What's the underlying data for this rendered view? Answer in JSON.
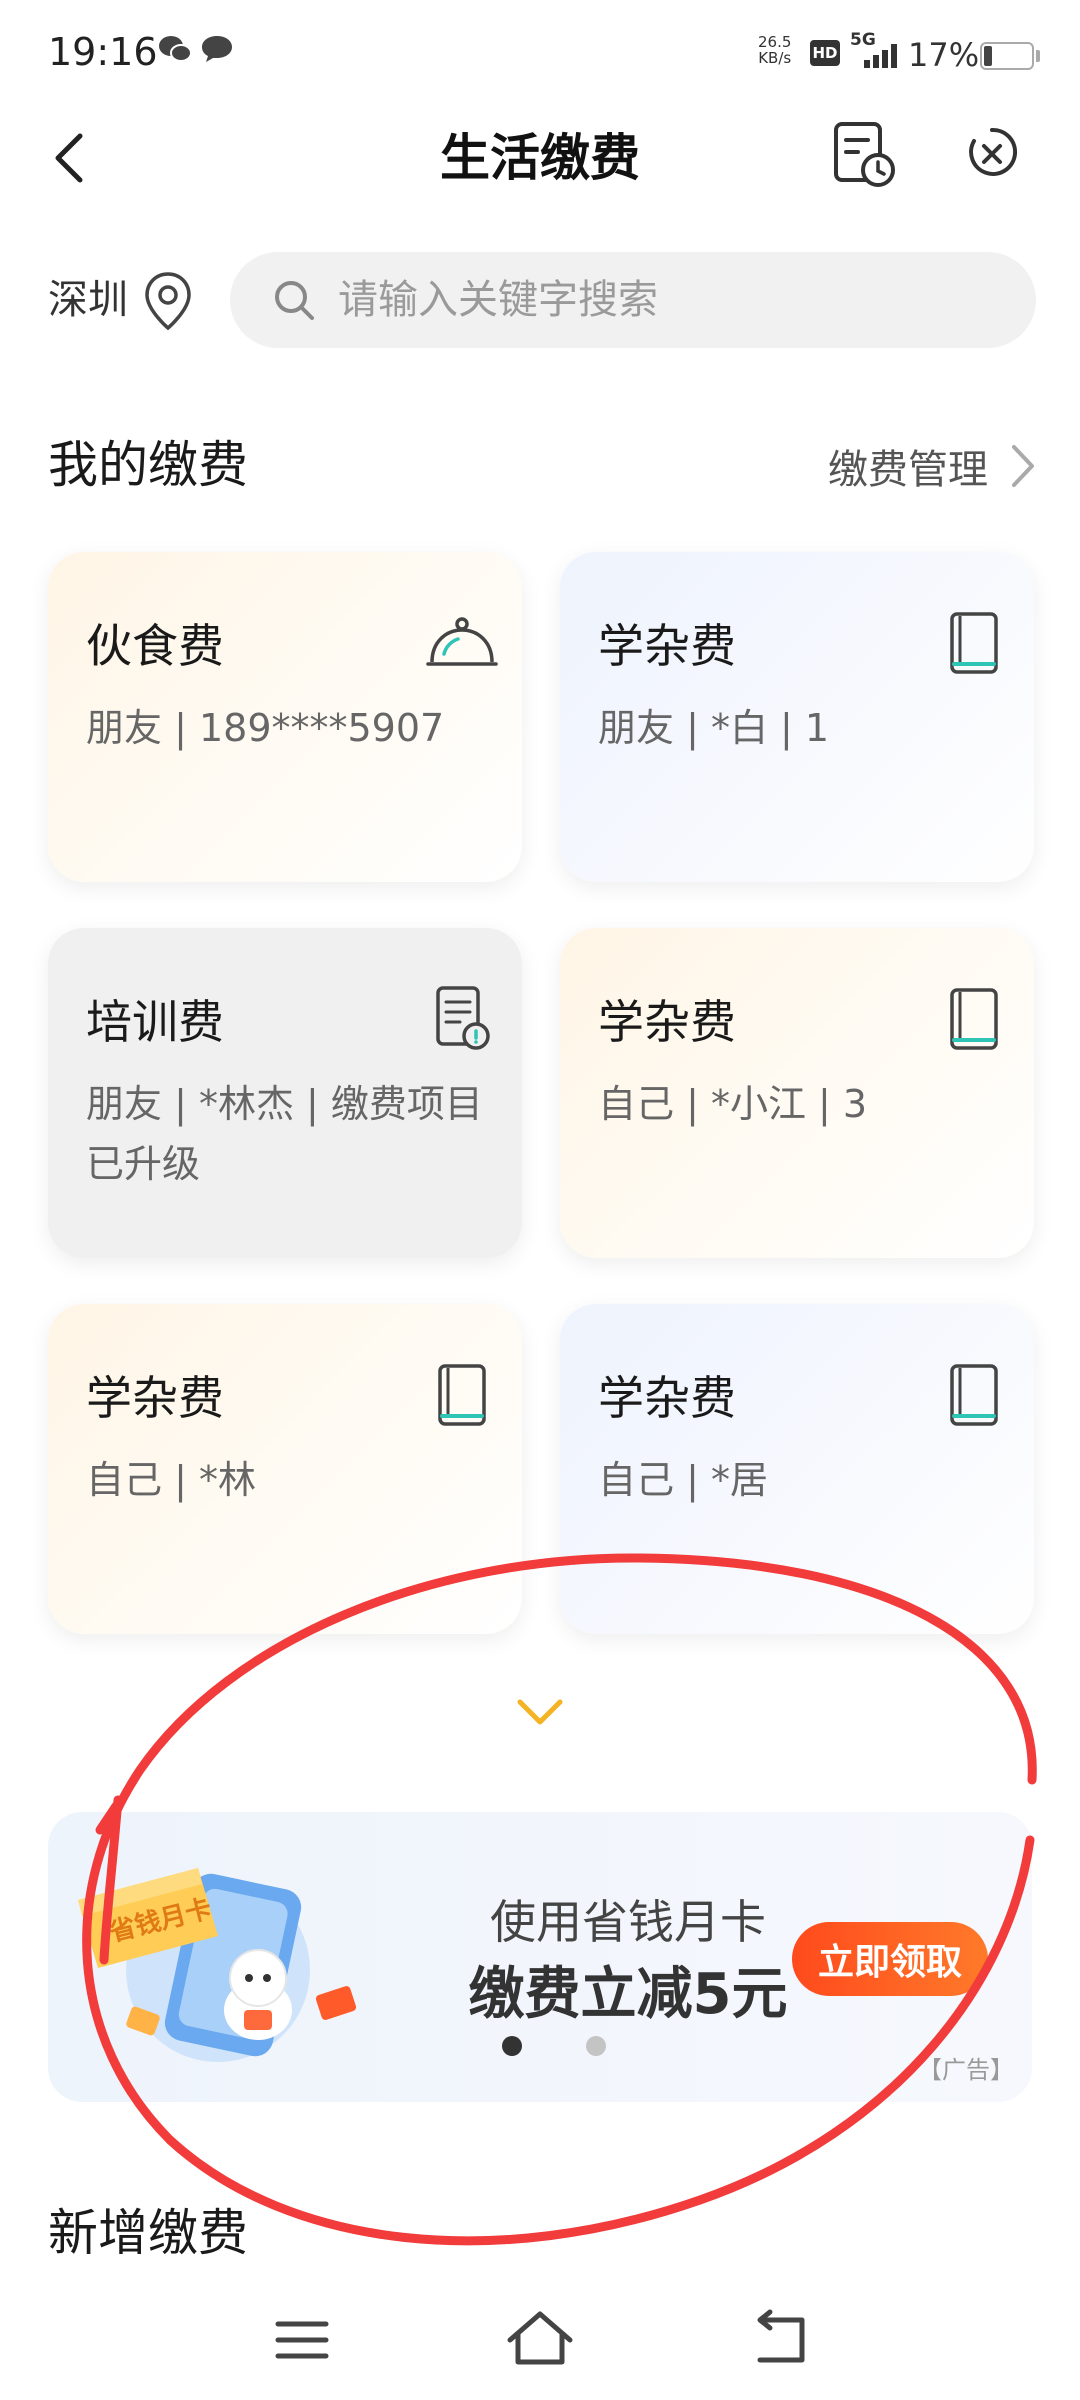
{
  "status_bar": {
    "time": "19:16",
    "net_speed_value": "26.5",
    "net_speed_unit": "KB/s",
    "hd": "HD",
    "network": "5G",
    "battery": "17%"
  },
  "header": {
    "title": "生活缴费"
  },
  "location": {
    "city": "深圳"
  },
  "search": {
    "placeholder": "请输入关键字搜索"
  },
  "my_payments": {
    "title": "我的缴费",
    "manage_label": "缴费管理",
    "cards": [
      {
        "title": "伙食费",
        "subtitle": "朋友 | 189****5907",
        "icon": "service-bell-icon"
      },
      {
        "title": "学杂费",
        "subtitle": "朋友 | *白 | 1",
        "icon": "book-icon"
      },
      {
        "title": "培训费",
        "subtitle": "朋友 | *林杰 | 缴费项目已升级",
        "icon": "document-alert-icon"
      },
      {
        "title": "学杂费",
        "subtitle": "自己 | *小江 | 3",
        "icon": "book-icon"
      },
      {
        "title": "学杂费",
        "subtitle": "自己 | *林",
        "icon": "book-icon"
      },
      {
        "title": "学杂费",
        "subtitle": "自己 | *居",
        "icon": "book-icon"
      }
    ]
  },
  "banner": {
    "line1": "使用省钱月卡",
    "line2": "缴费立减5元",
    "button": "立即领取",
    "art_text": "省钱月卡",
    "ad_label": "【广告】",
    "page_count": 2,
    "active_page": 1
  },
  "new_payment": {
    "title": "新增缴费"
  },
  "colors": {
    "accent_orange": "#ff5a1f",
    "chevron_gold": "#f5b324",
    "icon_teal": "#2ec4b6",
    "annotation_red": "#f23b3b"
  }
}
